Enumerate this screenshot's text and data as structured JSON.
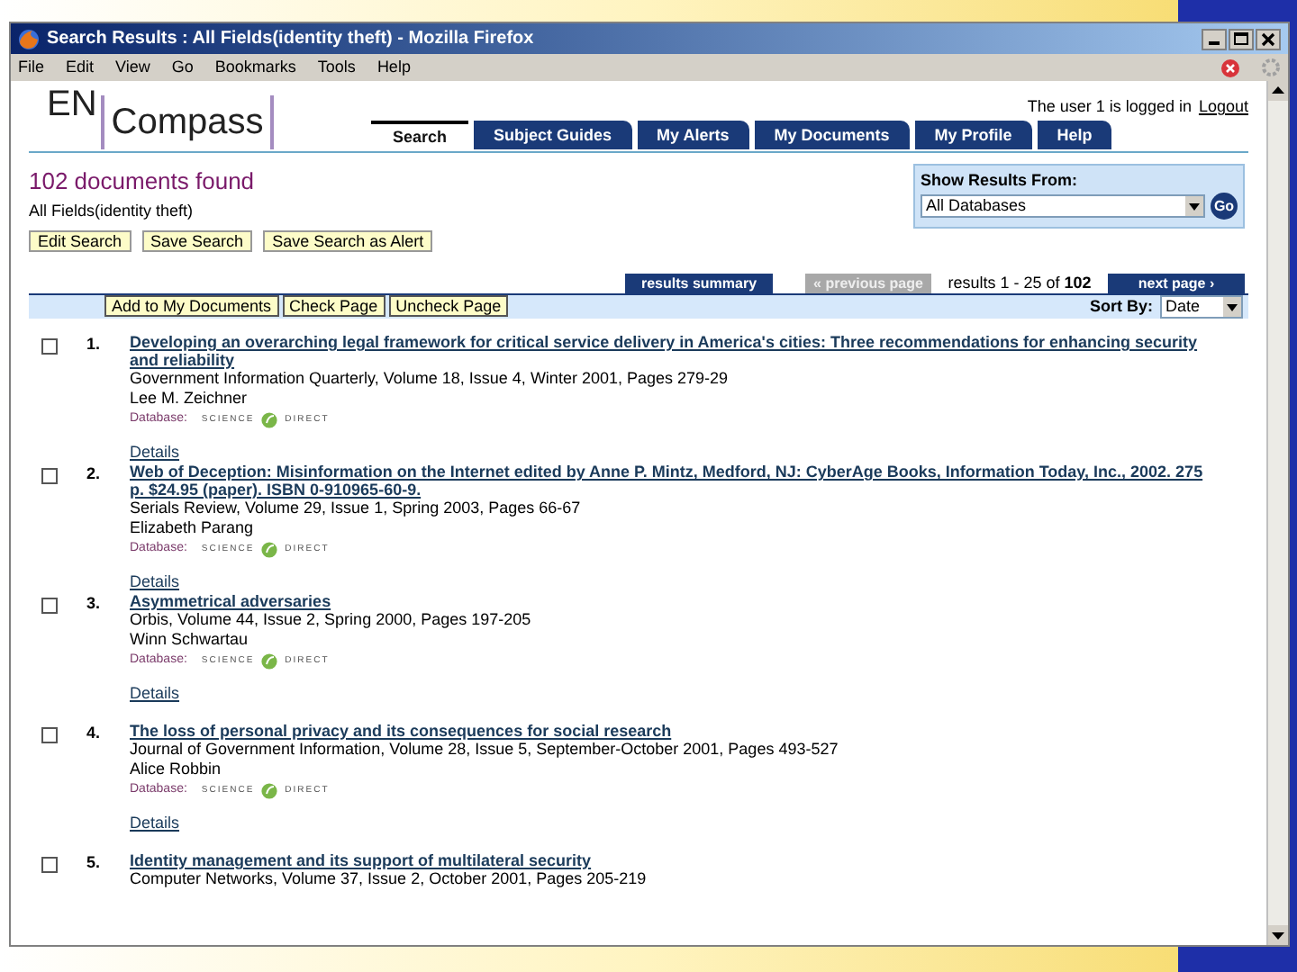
{
  "window": {
    "title": "Search Results : All Fields(identity theft) - Mozilla Firefox"
  },
  "menu": [
    "File",
    "Edit",
    "View",
    "Go",
    "Bookmarks",
    "Tools",
    "Help"
  ],
  "header": {
    "logo_left": "EN",
    "logo_right": "Compass",
    "login_text": "The user 1 is logged in",
    "logout": "Logout"
  },
  "tabs": [
    {
      "label": "Search",
      "selected": true
    },
    {
      "label": "Subject Guides",
      "selected": false
    },
    {
      "label": "My Alerts",
      "selected": false
    },
    {
      "label": "My Documents",
      "selected": false
    },
    {
      "label": "My Profile",
      "selected": false
    },
    {
      "label": "Help",
      "selected": false
    }
  ],
  "summary": {
    "heading": "102 documents found",
    "query": "All Fields(identity theft)",
    "buttons": [
      "Edit Search",
      "Save Search",
      "Save Search as Alert"
    ]
  },
  "source_box": {
    "label": "Show Results From:",
    "value": "All Databases",
    "go": "Go"
  },
  "pagination": {
    "summary_tab": "results summary",
    "previous": {
      "label": "« previous page",
      "disabled": true
    },
    "range": "results 1 - 25 of **102**",
    "next": "next page ›"
  },
  "toolbar": {
    "buttons": [
      "Add to My Documents",
      "Check Page",
      "Uncheck Page"
    ],
    "sort_label": "Sort By:",
    "sort_value": "Date"
  },
  "results": [
    {
      "number": "1.",
      "checked": false,
      "title": "Developing an overarching legal framework for critical service delivery in America's cities: Three recommendations for enhancing security and reliability",
      "source": "Government Information Quarterly, Volume 18, Issue 4, Winter 2001, Pages 279-29",
      "author": "Lee M. Zeichner",
      "database_label": "Database:",
      "database": [
        "SCIENCE",
        "DIRECT"
      ],
      "details": "Details"
    },
    {
      "number": "2.",
      "checked": false,
      "title": "Web of Deception: Misinformation on the Internet edited by Anne P. Mintz, Medford, NJ: CyberAge Books, Information Today, Inc., 2002. 275 p. $24.95 (paper). ISBN 0-910965-60-9.",
      "source": "Serials Review, Volume 29, Issue 1, Spring 2003, Pages 66-67",
      "author": "Elizabeth Parang",
      "database_label": "Database:",
      "database": [
        "SCIENCE",
        "DIRECT"
      ],
      "details": "Details"
    },
    {
      "number": "3.",
      "checked": false,
      "title": "Asymmetrical adversaries",
      "source": "Orbis, Volume 44, Issue 2, Spring 2000, Pages 197-205",
      "author": "Winn Schwartau",
      "database_label": "Database:",
      "database": [
        "SCIENCE",
        "DIRECT"
      ],
      "details": "Details"
    },
    {
      "number": "4.",
      "checked": false,
      "title": "The loss of personal privacy and its consequences for social research",
      "source": "Journal of Government Information, Volume 28, Issue 5, September-October 2001, Pages 493-527",
      "author": "Alice Robbin",
      "database_label": "Database:",
      "database": [
        "SCIENCE",
        "DIRECT"
      ],
      "details": "Details"
    },
    {
      "number": "5.",
      "checked": false,
      "title": "Identity management and its support of multilateral security",
      "source": "Computer Networks, Volume 37, Issue 2, October 2001, Pages 205-219"
    }
  ]
}
